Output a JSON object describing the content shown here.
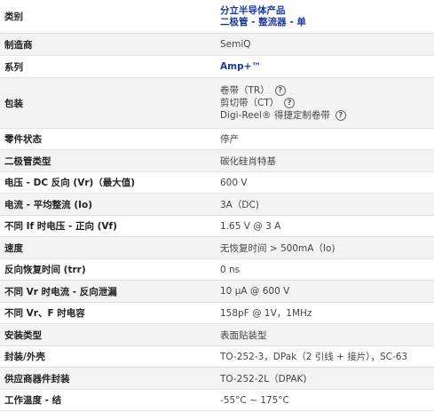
{
  "rows": [
    {
      "label": "类别",
      "links": [
        "分立半导体产品",
        "二极管 - 整流器 - 单"
      ]
    },
    {
      "label": "制造商",
      "value": "SemiQ"
    },
    {
      "label": "系列",
      "link": "Amp+™"
    },
    {
      "label": "包装",
      "options": [
        {
          "text": "卷带（TR）",
          "icon": "help-circle-icon"
        },
        {
          "text": "剪切带（CT）",
          "icon": "help-circle-icon"
        },
        {
          "text": "Digi-Reel® 得捷定制卷带",
          "icon": "help-circle-icon"
        }
      ]
    },
    {
      "label": "零件状态",
      "value": "停产"
    },
    {
      "label": "二极管类型",
      "value": "碳化硅肖特基"
    },
    {
      "label": "电压 - DC 反向 (Vr)（最大值)",
      "value": "600 V"
    },
    {
      "label": "电流 - 平均整流 (Io)",
      "value": "3A（DC)"
    },
    {
      "label": "不同 If 时电压 - 正向 (Vf)",
      "value": "1.65 V @ 3 A"
    },
    {
      "label": "速度",
      "value": "无恢复时间 > 500mA（Io)"
    },
    {
      "label": "反向恢复时间 (trr)",
      "value": "0 ns"
    },
    {
      "label": "不同 Vr 时电流 - 反向泄漏",
      "value": "10 µA @ 600 V"
    },
    {
      "label": "不同 Vr、F 时电容",
      "value": "158pF @ 1V，1MHz"
    },
    {
      "label": "安装类型",
      "value": "表面贴装型"
    },
    {
      "label": "封装/外壳",
      "value": "TO-252-3，DPak（2 引线 + 接片），SC-63"
    },
    {
      "label": "供应商器件封装",
      "value": "TO-252-2L（DPAK)"
    },
    {
      "label": "工作温度 - 结",
      "value": "-55°C ~ 175°C"
    }
  ],
  "colors": {
    "link": "#1a3a9a",
    "row_shade": "#f3f3f3",
    "divider": "#e2e2e2"
  }
}
